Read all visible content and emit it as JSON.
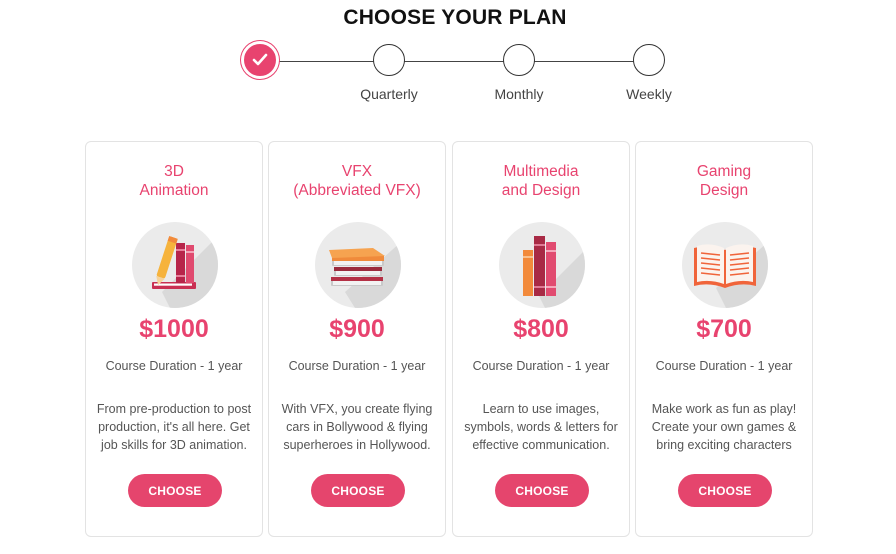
{
  "page": {
    "title": "CHOOSE YOUR PLAN"
  },
  "stepper": {
    "steps": [
      {
        "label": "",
        "state": "checked",
        "icon": "check-icon"
      },
      {
        "label": "Quarterly",
        "state": "default"
      },
      {
        "label": "Monthly",
        "state": "default"
      },
      {
        "label": "Weekly",
        "state": "default"
      }
    ]
  },
  "plans": [
    {
      "title": "3D\nAnimation",
      "icon": "books-pencil-icon",
      "price": "$1000",
      "duration": "Course Duration - 1 year",
      "description": "From pre-production to post production, it's all here. Get job skills for 3D animation.",
      "button": "CHOOSE"
    },
    {
      "title": "VFX\n(Abbreviated VFX)",
      "icon": "book-stack-icon",
      "price": "$900",
      "duration": "Course Duration - 1 year",
      "description": "With VFX, you create flying cars in Bollywood & flying superheroes in Hollywood.",
      "button": "CHOOSE"
    },
    {
      "title": "Multimedia\nand Design",
      "icon": "standing-books-icon",
      "price": "$800",
      "duration": "Course Duration - 1 year",
      "description": "Learn to use images, symbols, words & letters for effective communication.",
      "button": "CHOOSE"
    },
    {
      "title": "Gaming\nDesign",
      "icon": "open-book-icon",
      "price": "$700",
      "duration": "Course Duration - 1 year",
      "description": "Make work as fun as play! Create your own games & bring exciting characters",
      "button": "CHOOSE"
    }
  ],
  "colors": {
    "accent": "#e8436f",
    "button": "#e5456d",
    "icon_bg": "#ebebeb"
  }
}
